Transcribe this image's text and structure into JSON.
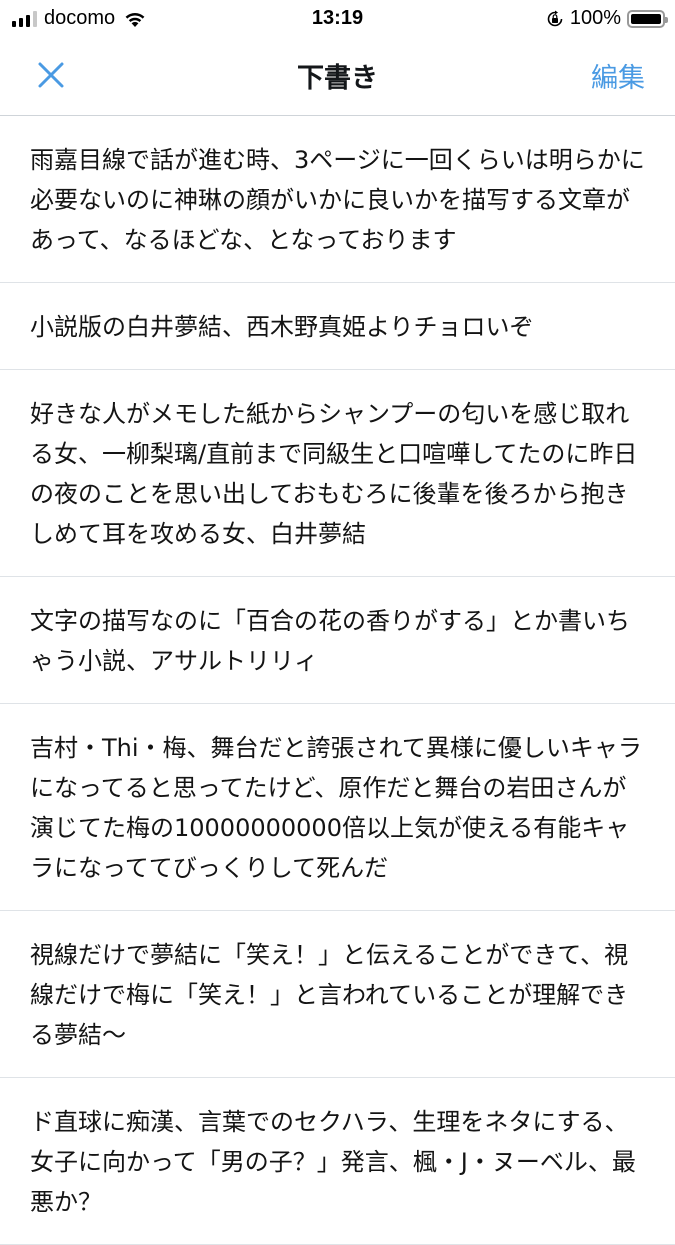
{
  "status_bar": {
    "carrier": "docomo",
    "time": "13:19",
    "battery_percent": "100%",
    "battery_level": 1.0,
    "signal_bars": 3,
    "signal_bars_total": 4
  },
  "nav": {
    "close_icon": "close-x-icon",
    "title": "下書き",
    "edit_label": "編集",
    "accent_color": "#4a9ae3"
  },
  "drafts": [
    {
      "text": "雨嘉目線で話が進む時、3ページに一回くらいは明らかに必要ないのに神琳の顔がいかに良いかを描写する文章があって、なるほどな、となっております"
    },
    {
      "text": "小説版の白井夢結、西木野真姫よりチョロいぞ"
    },
    {
      "text": "好きな人がメモした紙からシャンプーの匂いを感じ取れる女、一柳梨璃/直前まで同級生と口喧嘩してたのに昨日の夜のことを思い出しておもむろに後輩を後ろから抱きしめて耳を攻める女、白井夢結"
    },
    {
      "text": "文字の描写なのに「百合の花の香りがする」とか書いちゃう小説、アサルトリリィ"
    },
    {
      "text": "吉村・Thi・梅、舞台だと誇張されて異様に優しいキャラになってると思ってたけど、原作だと舞台の岩田さんが演じてた梅の10000000000倍以上気が使える有能キャラになっててびっくりして死んだ"
    },
    {
      "text": "視線だけで夢結に「笑え！」と伝えることができて、視線だけで梅に「笑え！」と言われていることが理解できる夢結〜"
    },
    {
      "text": "ド直球に痴漢、言葉でのセクハラ、生理をネタにする、女子に向かって「男の子？」発言、楓・J・ヌーベル、最悪か？"
    }
  ]
}
